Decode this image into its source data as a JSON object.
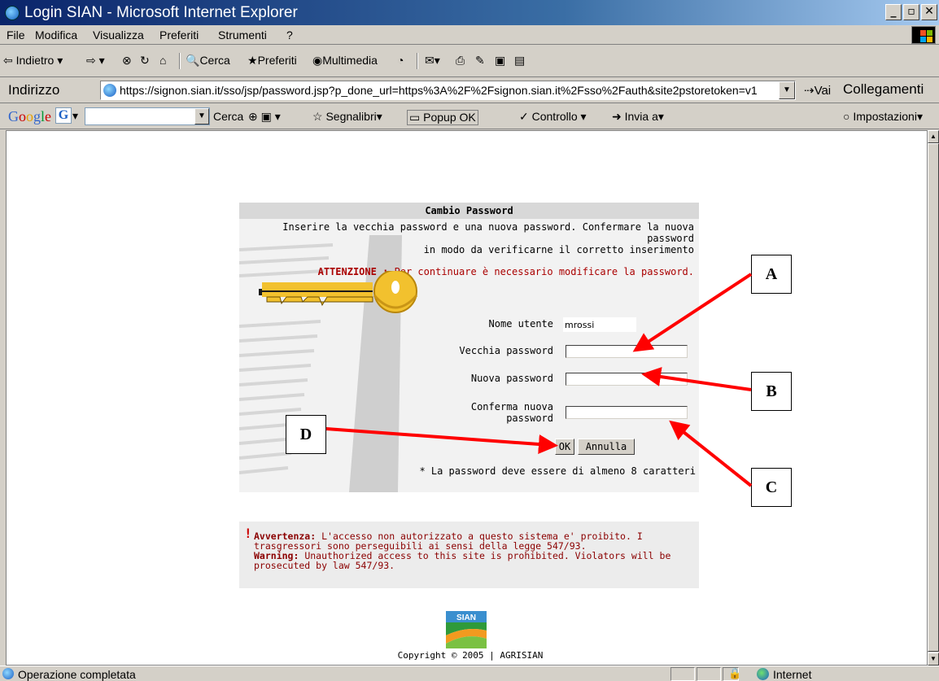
{
  "window": {
    "title": "Login SIAN - Microsoft Internet Explorer"
  },
  "menu": [
    "File",
    "Modifica",
    "Visualizza",
    "Preferiti",
    "Strumenti",
    "?"
  ],
  "toolbar": {
    "back": "Indietro",
    "search": "Cerca",
    "favorites": "Preferiti",
    "media": "Multimedia"
  },
  "address": {
    "label": "Indirizzo",
    "url": "https://signon.sian.it/sso/jsp/password.jsp?p_done_url=https%3A%2F%2Fsignon.sian.it%2Fsso%2Fauth&site2pstoretoken=v1",
    "go": "Vai",
    "links": "Collegamenti"
  },
  "google_toolbar": {
    "logo": "Google",
    "search": "Cerca",
    "bookmarks": "Segnalibri",
    "popup": "Popup OK",
    "spell": "Controllo",
    "send": "Invia a",
    "settings": "Impostazioni"
  },
  "panel": {
    "title": "Cambio Password",
    "intro_line1": "Inserire la vecchia password e una nuova password. Confermare la nuova password",
    "intro_line2": "in modo da verificarne il corretto inserimento",
    "attention_label": "ATTENZIONE :",
    "attention_text": "Per continuare è necessario modificare la password.",
    "username_label": "Nome utente",
    "username_value": "mrossi",
    "old_password_label": "Vecchia password",
    "new_password_label": "Nuova password",
    "confirm_label_line1": "Conferma nuova",
    "confirm_label_line2": "password",
    "ok_label": "OK",
    "cancel_label": "Annulla",
    "note": "* La password deve essere di almeno 8 caratteri"
  },
  "warning": {
    "it_label": "Avvertenza:",
    "it_text": "L'accesso non autorizzato a questo sistema e' proibito. I trasgressori sono perseguibili ai sensi della legge 547/93.",
    "en_label": "Warning:",
    "en_text": "Unauthorized access to this site is prohibited. Violators will be prosecuted by law 547/93."
  },
  "footer": {
    "logo_text": "SIAN",
    "copyright": "Copyright © 2005 | AGRISIAN"
  },
  "annotations": [
    "A",
    "B",
    "C",
    "D"
  ],
  "status": {
    "message": "Operazione completata",
    "zone": "Internet"
  },
  "colors": {
    "titlebar": "#0a246a",
    "attention": "#aa0000",
    "warning_text": "#8b0000",
    "arrow": "#ff0000",
    "key": "#f2c12e"
  }
}
